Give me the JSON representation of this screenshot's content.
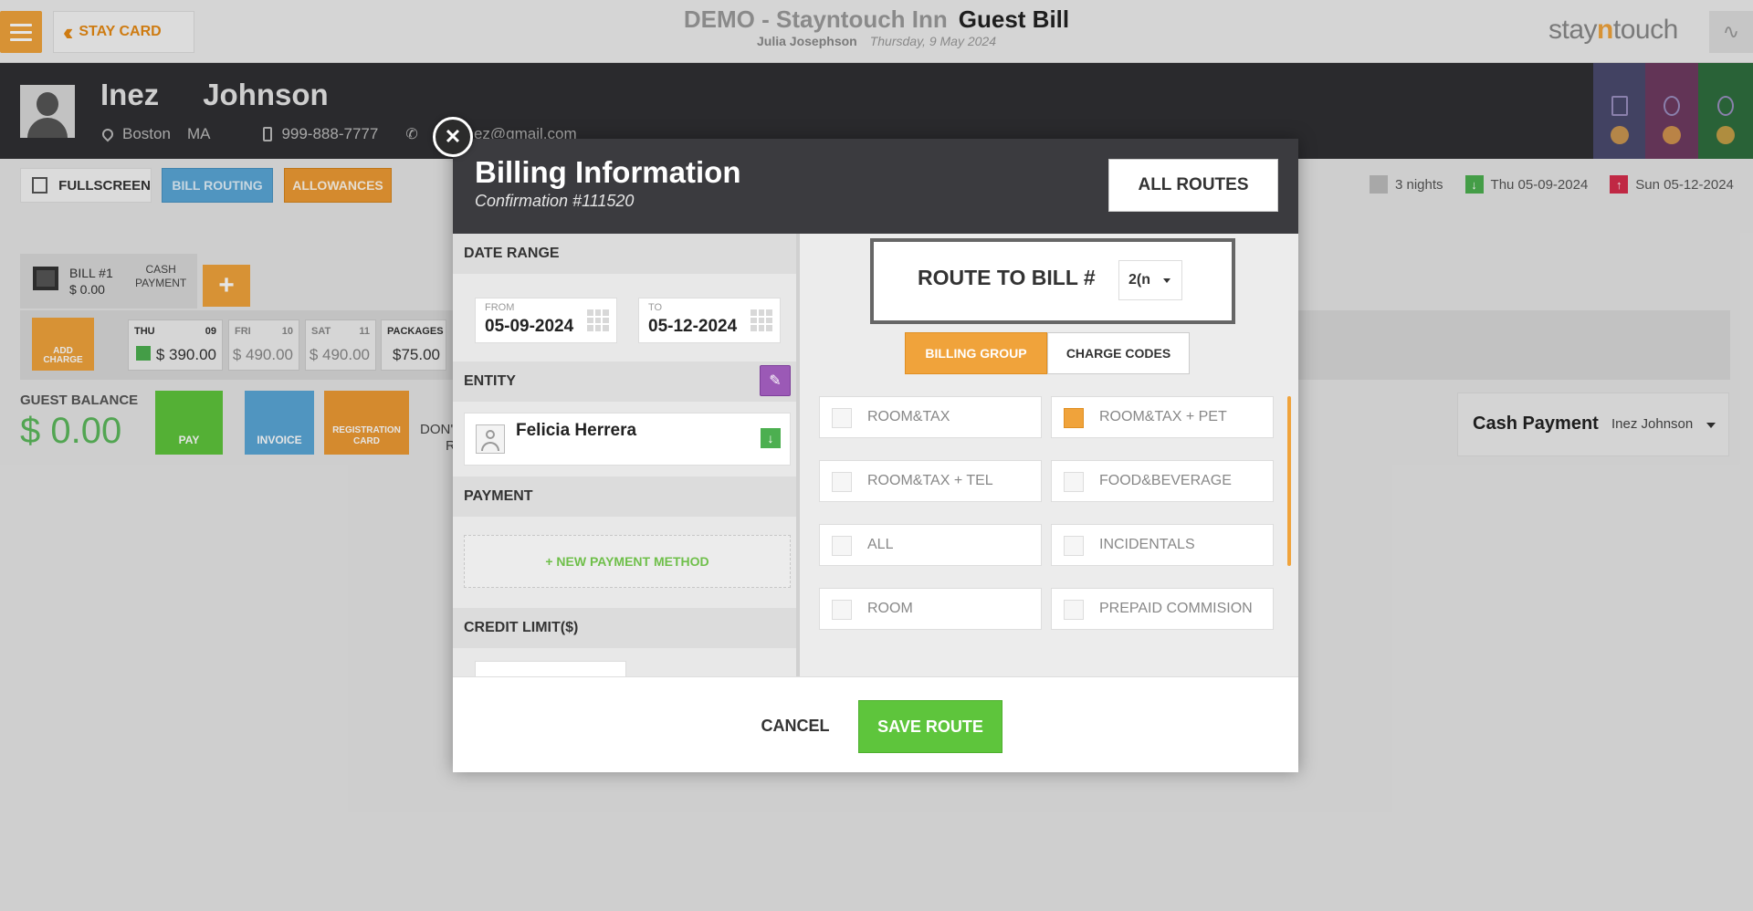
{
  "topbar": {
    "back_label": "STAY CARD",
    "hotel_name": "DEMO - Stayntouch Inn",
    "page_title": "Guest Bill",
    "user_name": "Julia Josephson",
    "date": "Thursday, 9 May 2024",
    "brand_pre": "stay",
    "brand_n": "n",
    "brand_post": "touch"
  },
  "guest": {
    "first_name": "Inez",
    "last_name": "Johnson",
    "city": "Boston",
    "state": "MA",
    "phone": "999-888-7777",
    "email": "inez@gmail.com",
    "side_tab_colors": [
      "#4a4a6e",
      "#6e3a60",
      "#2e6e3e"
    ]
  },
  "actions": {
    "fullscreen": "FULLSCREEN",
    "bill_routing": "BILL ROUTING",
    "allowances": "ALLOWANCES",
    "nights": "3 nights",
    "arrival": "Thu 05-09-2024",
    "departure": "Sun 05-12-2024"
  },
  "bill": {
    "name": "BILL #1",
    "amount": "$ 0.00",
    "cash_line1": "CASH",
    "cash_line2": "PAYMENT",
    "add_charge_line1": "ADD",
    "add_charge_line2": "CHARGE",
    "days": [
      {
        "day": "THU",
        "date": "09",
        "amount": "$ 390.00"
      },
      {
        "day": "FRI",
        "date": "10",
        "amount": "$ 490.00"
      },
      {
        "day": "SAT",
        "date": "11",
        "amount": "$ 490.00"
      },
      {
        "day": "PACKAGES",
        "date": "",
        "amount": "$75.00"
      }
    ],
    "guest_balance_label": "GUEST BALANCE",
    "guest_balance": "$ 0.00",
    "pay": "PAY",
    "invoice": "INVOICE",
    "registration_line1": "REGISTRATION",
    "registration_line2": "CARD",
    "dont_line1": "DON'",
    "dont_line2": "R",
    "cash_payment": "Cash Payment",
    "cash_payment_guest": "Inez Johnson"
  },
  "modal": {
    "title": "Billing Information",
    "confirmation": "Confirmation #111520",
    "all_routes": "ALL ROUTES",
    "date_range_label": "DATE RANGE",
    "from_label": "FROM",
    "from_value": "05-09-2024",
    "to_label": "TO",
    "to_value": "05-12-2024",
    "entity_label": "ENTITY",
    "entity_name": "Felicia Herrera",
    "payment_label": "PAYMENT",
    "new_payment": "+ NEW PAYMENT METHOD",
    "credit_limit_label": "CREDIT LIMIT($)",
    "route_to_bill": "ROUTE TO BILL #",
    "route_bill_value": "2(n",
    "tab_billing_group": "BILLING GROUP",
    "tab_charge_codes": "CHARGE CODES",
    "options": [
      {
        "label": "ROOM&TAX",
        "checked": false
      },
      {
        "label": "ROOM&TAX + PET",
        "checked": true
      },
      {
        "label": "ROOM&TAX + TEL",
        "checked": false
      },
      {
        "label": "FOOD&BEVERAGE",
        "checked": false
      },
      {
        "label": "ALL",
        "checked": false
      },
      {
        "label": "INCIDENTALS",
        "checked": false
      },
      {
        "label": "ROOM",
        "checked": false
      },
      {
        "label": "PREPAID COMMISION",
        "checked": false
      }
    ],
    "cancel": "CANCEL",
    "save": "SAVE ROUTE"
  },
  "colors": {
    "accent_orange": "#f0a33b",
    "save_green": "#5ec53c",
    "routing_blue": "#5aa6d6",
    "header_dark": "#2f2f33"
  }
}
